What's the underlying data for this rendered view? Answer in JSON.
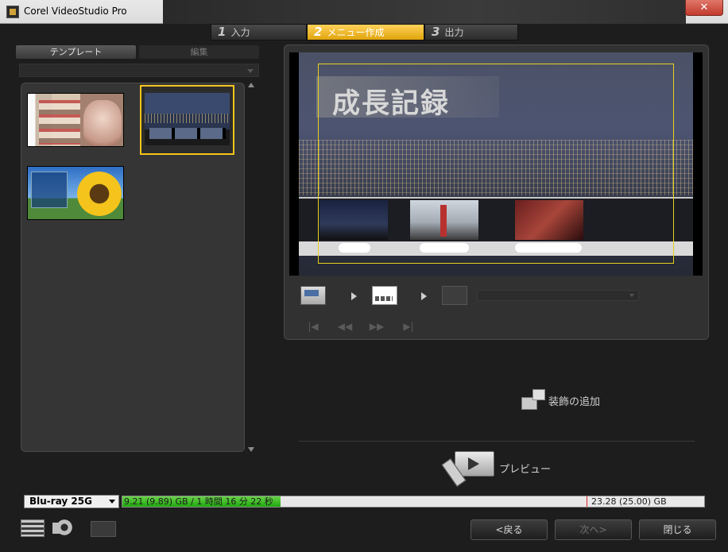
{
  "window": {
    "title": "Corel VideoStudio Pro",
    "close_label": "✕"
  },
  "steps": [
    {
      "num": "1",
      "label": "入力"
    },
    {
      "num": "2",
      "label": "メニュー作成"
    },
    {
      "num": "3",
      "label": "出力"
    }
  ],
  "left_panel": {
    "tabs": [
      {
        "label": "テンプレート"
      },
      {
        "label": "編集"
      }
    ],
    "category_selected": ""
  },
  "preview": {
    "menu_title": "成長記録"
  },
  "controls": {
    "deco_add_label": "装飾の追加",
    "preview_label": "プレビュー",
    "nav": [
      "|◀",
      "◀◀",
      "▶▶",
      "▶|"
    ]
  },
  "capacity": {
    "disc_type": "Blu-ray 25G",
    "used_text": "9.21 (9.89) GB / 1 時間 16 分 22 秒",
    "total_text": "23.28 (25.00) GB",
    "used_fraction": 0.272
  },
  "footer": {
    "back_label": "<戻る",
    "next_label": "次へ>",
    "close_label": "閉じる"
  },
  "colors": {
    "accent": "#f5c41c",
    "safe_area": "#e5d21c",
    "capacity_fill": "#1ea70e"
  }
}
